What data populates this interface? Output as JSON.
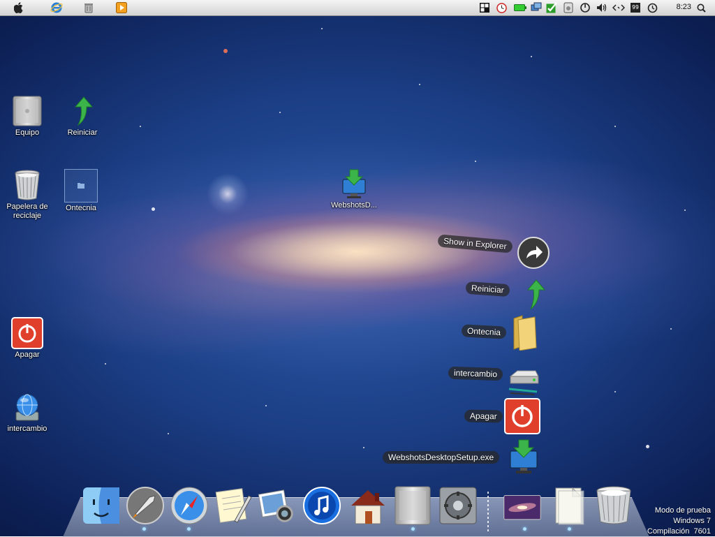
{
  "desktop_icons": [
    {
      "id": "equipo",
      "label": "Equipo",
      "icon": "computer-tower-icon"
    },
    {
      "id": "reiniciar",
      "label": "Reiniciar",
      "icon": "green-arrow-icon"
    },
    {
      "id": "papelera",
      "label": "Papelera de reciclaje",
      "icon": "recycle-bin-icon"
    },
    {
      "id": "ontecnia",
      "label": "Ontecnia",
      "icon": "folder-icon"
    },
    {
      "id": "webshots",
      "label": "WebshotsD...",
      "icon": "download-monitor-icon"
    },
    {
      "id": "apagar",
      "label": "Apagar",
      "icon": "power-icon"
    },
    {
      "id": "intercambio",
      "label": "intercambio",
      "icon": "network-globe-icon"
    }
  ],
  "stack": {
    "items": [
      {
        "label": "Show in Explorer",
        "icon": "share-arrow-icon"
      },
      {
        "label": "Reiniciar",
        "icon": "green-arrow-icon"
      },
      {
        "label": "Ontecnia",
        "icon": "folder-icon"
      },
      {
        "label": "intercambio",
        "icon": "network-drive-icon"
      },
      {
        "label": "Apagar",
        "icon": "power-icon"
      },
      {
        "label": "WebshotsDesktopSetup.exe",
        "icon": "download-monitor-icon"
      }
    ]
  },
  "menubar": {
    "left_icons": [
      "apple-icon",
      "internet-explorer-icon",
      "trash-icon",
      "media-player-icon"
    ],
    "tray_icons": [
      "grid-icon",
      "clock-icon",
      "battery-icon",
      "network-icon",
      "checkmark-icon",
      "device-icon",
      "power-icon",
      "volume-icon",
      "code-icon",
      "calendar-icon",
      "history-icon"
    ],
    "calendar_number": "99",
    "clock": "8:23"
  },
  "dock": {
    "items": [
      "finder-icon",
      "launchpad-icon",
      "safari-icon",
      "notes-icon",
      "photo-icon",
      "itunes-icon",
      "home-icon",
      "mac-pro-icon",
      "system-preferences-icon",
      "desktop-stack-icon",
      "documents-stack-icon",
      "trash-icon"
    ]
  },
  "watermark": {
    "line1": "Modo de prueba",
    "line2": "Windows 7",
    "line3": "Compilación  7601"
  },
  "colors": {
    "space_dark": "#071236",
    "space_blue": "#2b5aa8",
    "power_red": "#e0402b",
    "arrow_green": "#3bb54a"
  }
}
